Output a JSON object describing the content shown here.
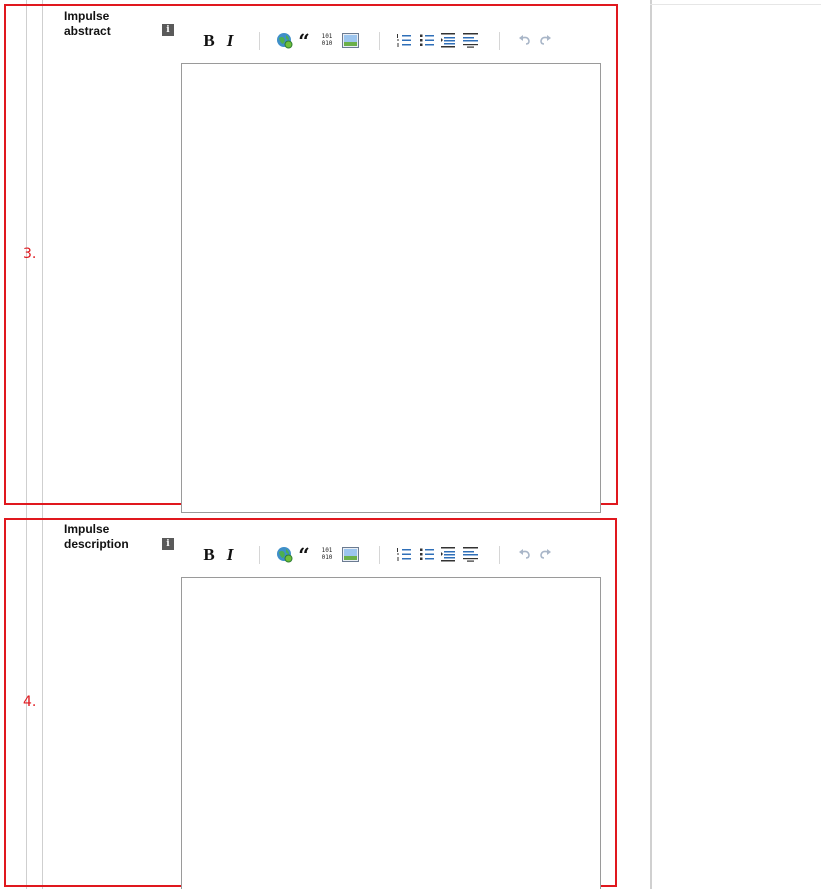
{
  "sections": [
    {
      "number": "3.",
      "label_line1": "Impulse",
      "label_line2": "abstract",
      "info_glyph": "i",
      "toolbar": {
        "bold": "B",
        "italic": "I",
        "quote": "“",
        "code_top": "101",
        "code_bottom": "010"
      },
      "editor_value": ""
    },
    {
      "number": "4.",
      "label_line1": "Impulse",
      "label_line2": "description",
      "info_glyph": "i",
      "toolbar": {
        "bold": "B",
        "italic": "I",
        "quote": "“",
        "code_top": "101",
        "code_bottom": "010"
      },
      "editor_value": ""
    }
  ],
  "colors": {
    "annotation_red": "#e0181e",
    "undo_redo_disabled": "#a9b6c8"
  },
  "icons": [
    "bold-icon",
    "italic-icon",
    "link-globe-icon",
    "blockquote-icon",
    "code-icon",
    "image-icon",
    "ordered-list-icon",
    "unordered-list-icon",
    "indent-icon",
    "outdent-icon",
    "undo-icon",
    "redo-icon",
    "info-icon"
  ]
}
